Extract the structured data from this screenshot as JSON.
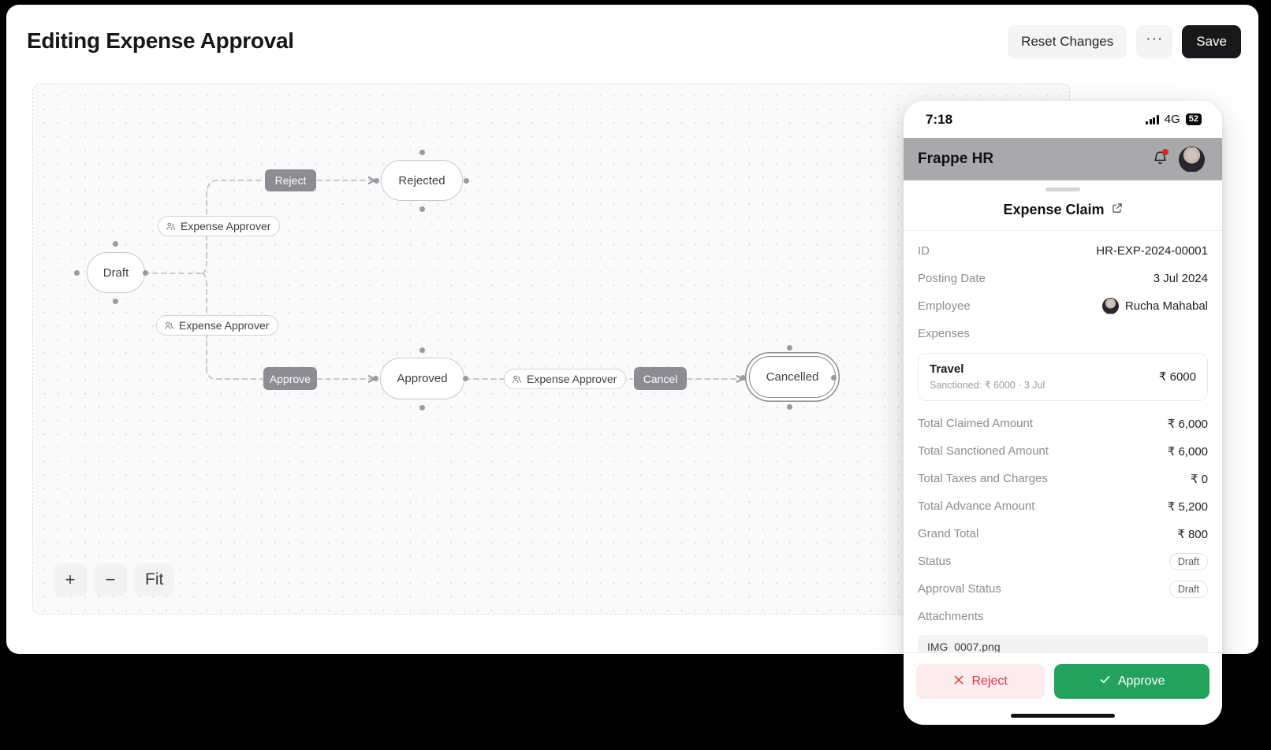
{
  "header": {
    "title": "Editing Expense Approval",
    "reset_label": "Reset Changes",
    "more_label": "···",
    "save_label": "Save"
  },
  "canvas": {
    "zoom_in_label": "+",
    "zoom_out_label": "−",
    "fit_label": "Fit",
    "nodes": [
      {
        "id": "draft",
        "label": "Draft"
      },
      {
        "id": "rejected",
        "label": "Rejected"
      },
      {
        "id": "approved",
        "label": "Approved"
      },
      {
        "id": "cancelled",
        "label": "Cancelled"
      }
    ],
    "actions": [
      {
        "id": "reject",
        "label": "Reject"
      },
      {
        "id": "approve",
        "label": "Approve"
      },
      {
        "id": "cancel",
        "label": "Cancel"
      }
    ],
    "roles": [
      {
        "id": "role-reject",
        "label": "Expense Approver"
      },
      {
        "id": "role-approve",
        "label": "Expense Approver"
      },
      {
        "id": "role-cancel",
        "label": "Expense Approver"
      }
    ]
  },
  "phone": {
    "status": {
      "time": "7:18",
      "network": "4G",
      "battery": "52"
    },
    "nav": {
      "title": "Frappe HR"
    },
    "sheet": {
      "title": "Expense Claim",
      "fields": [
        {
          "label": "ID",
          "value": "HR-EXP-2024-00001",
          "type": "text"
        },
        {
          "label": "Posting Date",
          "value": "3 Jul 2024",
          "type": "text"
        },
        {
          "label": "Employee",
          "value": "Rucha Mahabal",
          "type": "avatar"
        }
      ],
      "expenses_label": "Expenses",
      "expense_item": {
        "name": "Travel",
        "subtitle": "Sanctioned: ₹ 6000 · 3 Jul",
        "amount": "₹ 6000"
      },
      "totals": [
        {
          "label": "Total Claimed Amount",
          "value": "₹ 6,000"
        },
        {
          "label": "Total Sanctioned Amount",
          "value": "₹ 6,000"
        },
        {
          "label": "Total Taxes and Charges",
          "value": "₹ 0"
        },
        {
          "label": "Total Advance Amount",
          "value": "₹ 5,200"
        },
        {
          "label": "Grand Total",
          "value": "₹ 800"
        }
      ],
      "statuses": [
        {
          "label": "Status",
          "value": "Draft"
        },
        {
          "label": "Approval Status",
          "value": "Draft"
        }
      ],
      "attachments_label": "Attachments",
      "attachment_file": "IMG_0007.png"
    },
    "footer": {
      "reject_label": "Reject",
      "approve_label": "Approve"
    }
  },
  "colors": {
    "approve_green": "#22a25c",
    "reject_red": "#dc3545",
    "save_black": "#18181b",
    "chip_gray": "#8c8c92"
  }
}
